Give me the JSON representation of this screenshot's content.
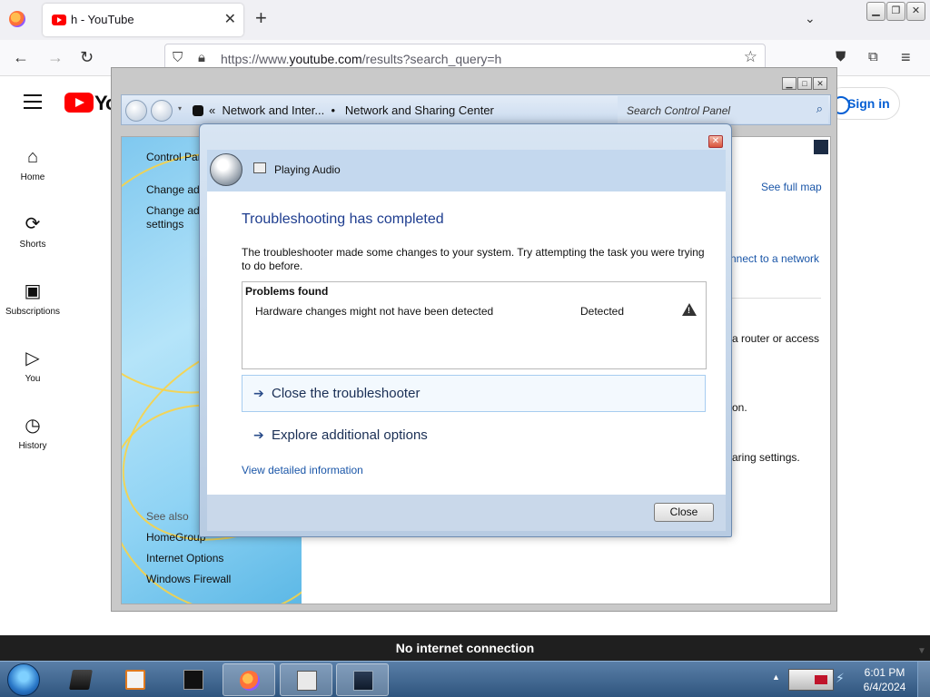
{
  "browser": {
    "tab_title": "h - YouTube",
    "url_prefix": "https://www.",
    "url_domain": "youtube.com",
    "url_suffix": "/results?search_query=h",
    "new_tab_glyph": "+",
    "close_glyph": "✕"
  },
  "youtube": {
    "logo_text": "Yo",
    "sign_in": "Sign in",
    "guide": [
      {
        "label": "Home",
        "icon": "home-icon"
      },
      {
        "label": "Shorts",
        "icon": "shorts-icon"
      },
      {
        "label": "Subscriptions",
        "icon": "subscriptions-icon"
      },
      {
        "label": "You",
        "icon": "you-icon"
      },
      {
        "label": "History",
        "icon": "history-icon"
      }
    ]
  },
  "control_panel": {
    "breadcrumb_1": "Network and Inter...",
    "breadcrumb_2": "Network and Sharing Center",
    "search_placeholder": "Search Control Panel",
    "left_links": [
      "Control Par",
      "Change ada",
      "Change adv",
      "settings"
    ],
    "see_also": "See also",
    "see_also_links": [
      "HomeGroup",
      "Internet Options",
      "Windows Firewall"
    ],
    "right_texts": {
      "see_full_map": "See full map",
      "connect": "nnect to a network",
      "router": "a router or access",
      "on": "on.",
      "sharing": "aring settings."
    }
  },
  "troubleshooter": {
    "app_name": "Playing Audio",
    "heading": "Troubleshooting has completed",
    "description": "The troubleshooter made some changes to your system. Try attempting the task you were trying to do before.",
    "problems_header": "Problems found",
    "problems": [
      {
        "name": "Hardware changes might not have been detected",
        "status": "Detected",
        "icon": "warning-icon"
      }
    ],
    "options": [
      "Close the troubleshooter",
      "Explore additional options"
    ],
    "details_link": "View detailed information",
    "close_button": "Close"
  },
  "notification": "No internet connection",
  "taskbar": {
    "time": "6:01 PM",
    "date": "6/4/2024"
  },
  "colors": {
    "youtube_red": "#ff0000",
    "link_blue": "#1a56a8",
    "heading_blue": "#1e3d8f",
    "taskbar_top": "#5a7fa8"
  }
}
